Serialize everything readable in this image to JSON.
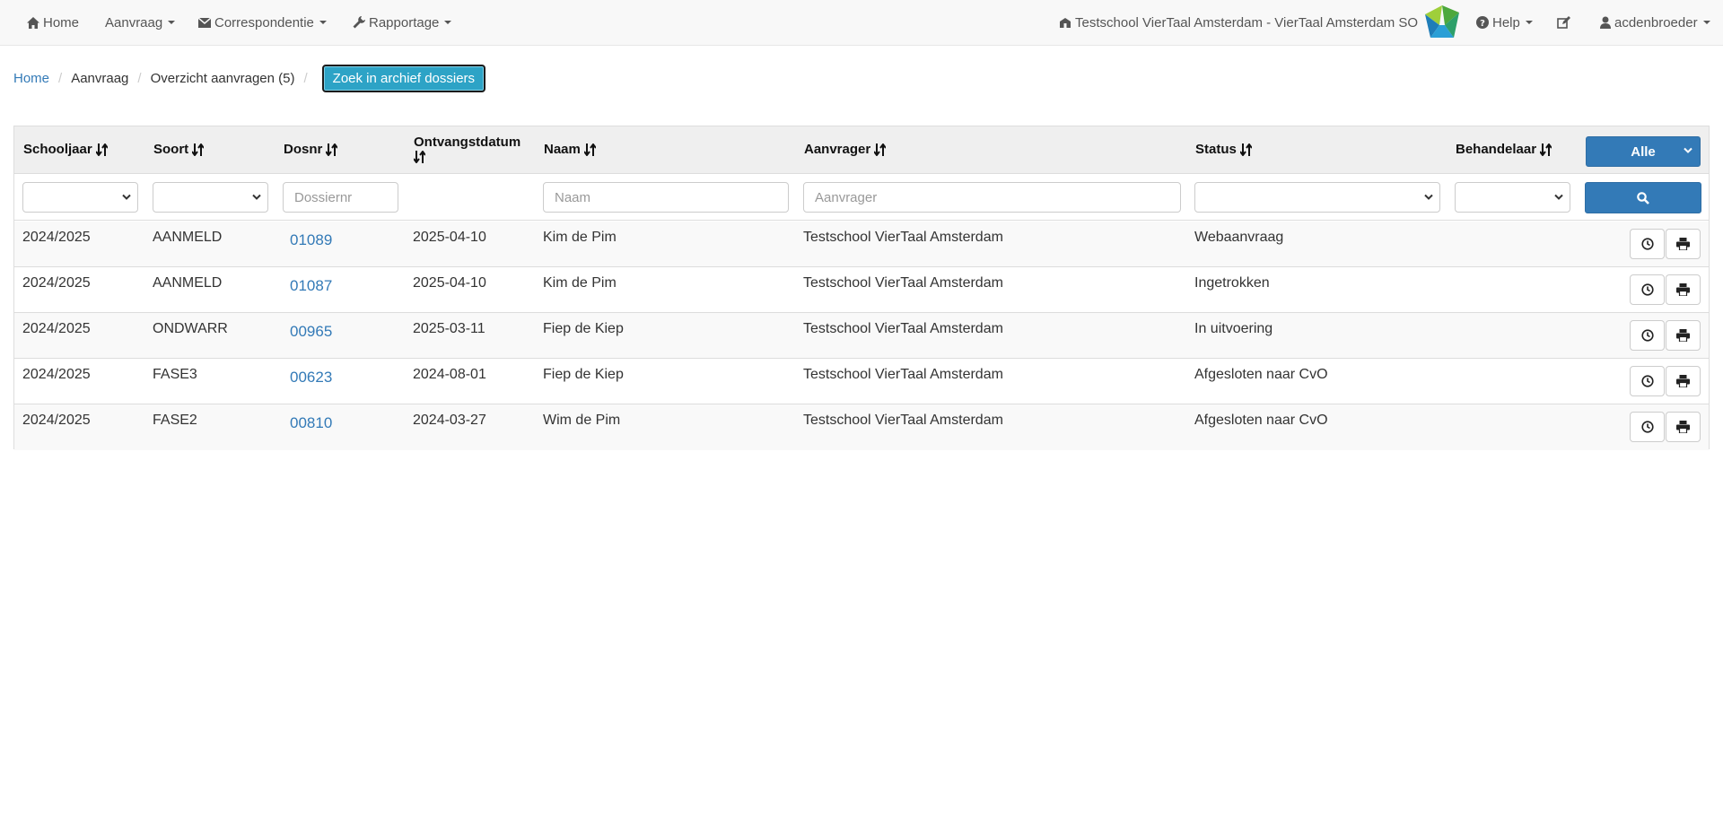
{
  "navbar": {
    "home": "Home",
    "aanvraag": "Aanvraag",
    "correspondentie": "Correspondentie",
    "rapportage": "Rapportage",
    "school": "Testschool VierTaal Amsterdam - VierTaal Amsterdam SO",
    "help": "Help",
    "user": "acdenbroeder"
  },
  "breadcrumb": {
    "home": "Home",
    "aanvraag": "Aanvraag",
    "overzicht": "Overzicht aanvragen (5)",
    "archive_button": "Zoek in archief dossiers"
  },
  "table": {
    "columns": {
      "schooljaar": "Schooljaar",
      "soort": "Soort",
      "dosnr": "Dosnr",
      "ontvangstdatum": "Ontvangstdatum",
      "naam": "Naam",
      "aanvrager": "Aanvrager",
      "status": "Status",
      "behandelaar": "Behandelaar"
    },
    "filter_all": "Alle",
    "filters": {
      "dosnr_placeholder": "Dossiernr",
      "naam_placeholder": "Naam",
      "aanvrager_placeholder": "Aanvrager"
    },
    "rows": [
      {
        "schooljaar": "2024/2025",
        "soort": "AANMELD",
        "dosnr": "01089",
        "datum": "2025-04-10",
        "naam": "Kim de Pim",
        "aanvrager": "Testschool VierTaal Amsterdam",
        "status": "Webaanvraag"
      },
      {
        "schooljaar": "2024/2025",
        "soort": "AANMELD",
        "dosnr": "01087",
        "datum": "2025-04-10",
        "naam": "Kim de Pim",
        "aanvrager": "Testschool VierTaal Amsterdam",
        "status": "Ingetrokken"
      },
      {
        "schooljaar": "2024/2025",
        "soort": "ONDWARR",
        "dosnr": "00965",
        "datum": "2025-03-11",
        "naam": "Fiep de Kiep",
        "aanvrager": "Testschool VierTaal Amsterdam",
        "status": "In uitvoering"
      },
      {
        "schooljaar": "2024/2025",
        "soort": "FASE3",
        "dosnr": "00623",
        "datum": "2024-08-01",
        "naam": "Fiep de Kiep",
        "aanvrager": "Testschool VierTaal Amsterdam",
        "status": "Afgesloten naar CvO"
      },
      {
        "schooljaar": "2024/2025",
        "soort": "FASE2",
        "dosnr": "00810",
        "datum": "2024-03-27",
        "naam": "Wim de Pim",
        "aanvrager": "Testschool VierTaal Amsterdam",
        "status": "Afgesloten naar CvO"
      }
    ]
  },
  "icons": {
    "home": "home-icon",
    "mail": "envelope-icon",
    "wrench": "wrench-icon",
    "school": "school-icon",
    "help": "question-icon",
    "edit": "edit-icon",
    "user": "user-icon",
    "sort": "sort-icon",
    "search": "search-icon",
    "history": "clock-icon",
    "print": "print-icon"
  },
  "colors": {
    "link": "#337ab7",
    "primary": "#337ab7",
    "archive_button": "#2da3c6"
  }
}
